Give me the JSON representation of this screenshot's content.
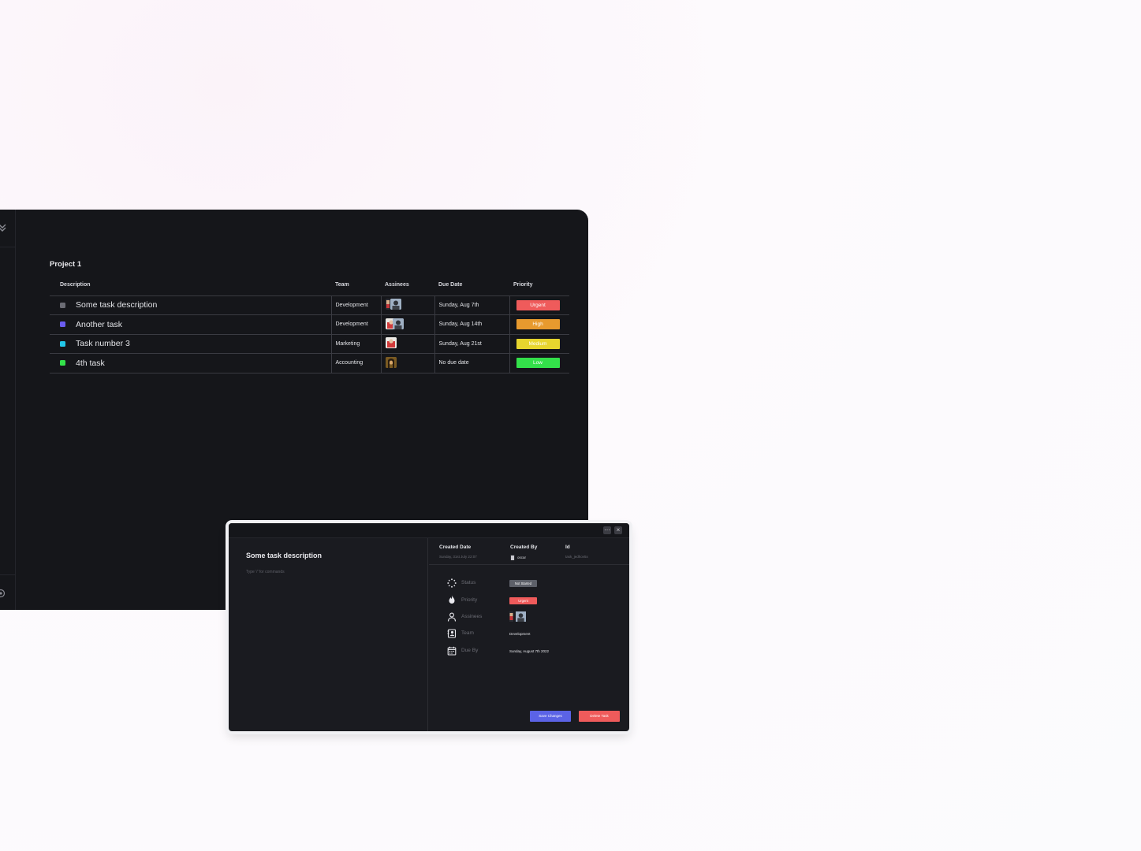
{
  "colors": {
    "window_bg": "#15161a",
    "urgent": "#ef5b5b",
    "high": "#e79a2e",
    "medium": "#e7d52e",
    "low": "#33e14a",
    "not_started": "#5d6069",
    "save": "#5b63e6",
    "delete": "#ef5b5b"
  },
  "project": {
    "title": "Project 1"
  },
  "table": {
    "headers": {
      "description": "Description",
      "team": "Team",
      "assignees": "Assinees",
      "due_date": "Due Date",
      "priority": "Priority"
    },
    "rows": [
      {
        "description": "Some task description",
        "dot_color": "#6b6c74",
        "team": "Development",
        "due": "Sunday, Aug 7th",
        "priority": "Urgent",
        "priority_color": "#ef5b5b"
      },
      {
        "description": "Another task",
        "dot_color": "#6a5cf0",
        "team": "Development",
        "due": "Sunday, Aug 14th",
        "priority": "High",
        "priority_color": "#e79a2e"
      },
      {
        "description": "Task number 3",
        "dot_color": "#22c7e8",
        "team": "Marketing",
        "due": "Sunday, Aug 21st",
        "priority": "Medium",
        "priority_color": "#e7d52e"
      },
      {
        "description": "4th task",
        "dot_color": "#33e14a",
        "team": "Accounting",
        "due": "No due date",
        "priority": "Low",
        "priority_color": "#33e14a"
      }
    ]
  },
  "modal": {
    "task_title": "Some task description",
    "hint": "Type '/' for commands",
    "created_date_label": "Created Date",
    "created_date_value": "Sunday, 31st July 22:07",
    "created_by_label": "Created By",
    "created_by_value": "oscar",
    "id_label": "Id",
    "id_value": "task_jedhov5x",
    "properties": {
      "status_label": "Status",
      "status_value": "Not Started",
      "priority_label": "Priority",
      "priority_value": "Urgent",
      "assignees_label": "Assinees",
      "team_label": "Team",
      "team_value": "Development",
      "due_label": "Due By",
      "due_value": "Sunday, August 7th 2022"
    },
    "save_label": "Save Changes",
    "delete_label": "Delete Task",
    "minimize_icon": "minimize-icon",
    "close_icon": "close-icon"
  }
}
